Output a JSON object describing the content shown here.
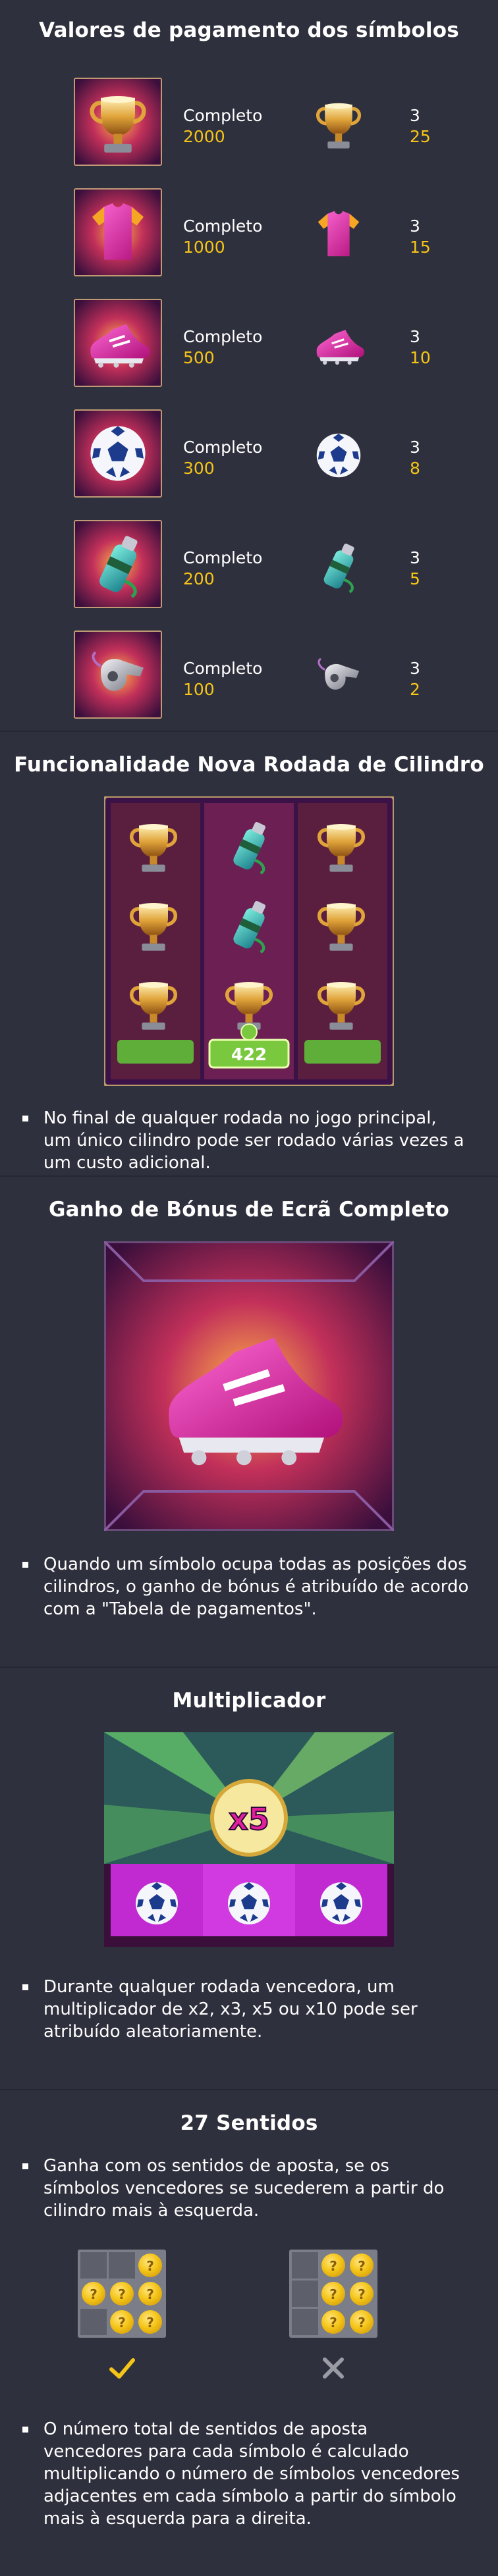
{
  "paytable": {
    "title": "Valores de pagamento dos símbolos",
    "rows": [
      {
        "icon": "trophy-icon",
        "label": "Completo",
        "value": "2000",
        "count": "3",
        "amount": "25"
      },
      {
        "icon": "jersey-icon",
        "label": "Completo",
        "value": "1000",
        "count": "3",
        "amount": "15"
      },
      {
        "icon": "boot-icon",
        "label": "Completo",
        "value": "500",
        "count": "3",
        "amount": "10"
      },
      {
        "icon": "ball-icon",
        "label": "Completo",
        "value": "300",
        "count": "3",
        "amount": "8"
      },
      {
        "icon": "bottle-icon",
        "label": "Completo",
        "value": "200",
        "count": "3",
        "amount": "5"
      },
      {
        "icon": "whistle-icon",
        "label": "Completo",
        "value": "100",
        "count": "3",
        "amount": "2"
      }
    ]
  },
  "respin": {
    "title": "Funcionalidade Nova Rodada de Cilindro",
    "counter": "422",
    "text": "No final de qualquer rodada no jogo principal, um único cilindro pode ser rodado várias vezes a um custo adicional."
  },
  "fullscreen": {
    "title": "Ganho de Bónus de Ecrã Completo",
    "text": "Quando um símbolo ocupa todas as posições dos cilindros, o ganho de bónus é atribuído de acordo com a \"Tabela de pagamentos\"."
  },
  "multiplier": {
    "title": "Multiplicador",
    "badge": "x5",
    "text": "Durante qualquer rodada vencedora, um multiplicador de x2, x3, x5 ou x10 pode ser atribuído aleatoriamente."
  },
  "ways": {
    "title": "27 Sentidos",
    "text1": "Ganha com os sentidos de aposta, se os símbolos vencedores se sucederem a partir do cilindro mais à esquerda.",
    "valid_mark": "check-icon",
    "invalid_mark": "cross-icon",
    "text2": "O número total de sentidos de aposta vencedores para cada símbolo é calculado multiplicando o número de símbolos vencedores adjacentes em cada símbolo a partir do símbolo mais à esquerda para a direita."
  },
  "colors": {
    "background": "#2f303d",
    "accent_gold": "#f5c518",
    "check": "#f5c518",
    "cross": "#9a9ba4"
  }
}
